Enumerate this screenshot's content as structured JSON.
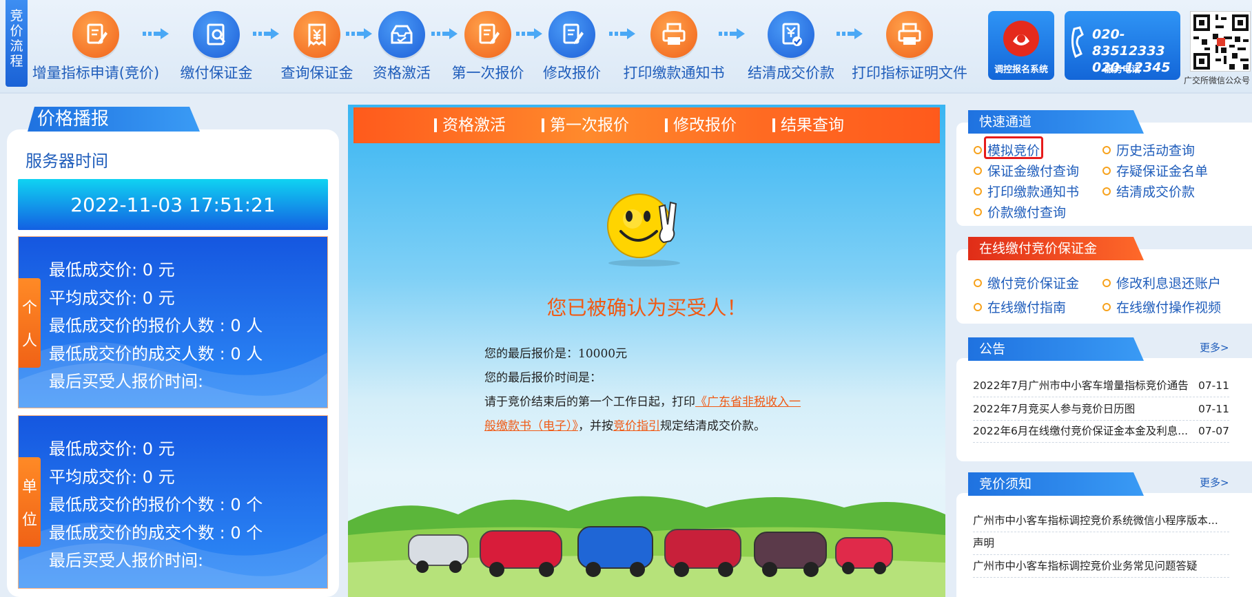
{
  "top_steps": {
    "side_tab": "竞价流程",
    "steps": [
      {
        "label": "增量指标申请(竞价)",
        "color": "orange",
        "icon": "form-edit-icon"
      },
      {
        "label": "缴付保证金",
        "color": "blue",
        "icon": "search-document-icon"
      },
      {
        "label": "查询保证金",
        "color": "orange",
        "icon": "yen-receipt-icon"
      },
      {
        "label": "资格激活",
        "color": "blue",
        "icon": "inbox-check-icon"
      },
      {
        "label": "第一次报价",
        "color": "orange",
        "icon": "form-edit-icon"
      },
      {
        "label": "修改报价",
        "color": "blue",
        "icon": "form-edit-icon"
      },
      {
        "label": "打印缴款通知书",
        "color": "orange",
        "icon": "printer-icon"
      },
      {
        "label": "结清成交价款",
        "color": "blue",
        "icon": "yen-check-icon"
      },
      {
        "label": "打印指标证明文件",
        "color": "orange",
        "icon": "printer-icon"
      }
    ],
    "badge_system": "调控报名系统",
    "phone_lines": [
      "020-83512333",
      "020-12345"
    ],
    "phone_caption": "服务电话",
    "qr_caption": "广交所微信公众号"
  },
  "left": {
    "tab_title": "价格播报",
    "server_label": "服务器时间",
    "server_time": "2022-11-03 17:51:21",
    "personal": {
      "tag": [
        "个",
        "人"
      ],
      "lines": [
        "最低成交价: 0 元",
        "平均成交价:  0 元",
        "最低成交价的报价人数 : 0 人",
        "最低成交价的成交人数 : 0 人",
        "最后买受人报价时间:"
      ]
    },
    "company": {
      "tag": [
        "单",
        "位"
      ],
      "lines": [
        "最低成交价: 0 元",
        "平均成交价:  0 元",
        "最低成交价的报价个数 : 0 个",
        "最低成交价的成交个数 : 0 个",
        "最后买受人报价时间:"
      ]
    }
  },
  "center": {
    "nav": [
      "资格激活",
      "第一次报价",
      "修改报价",
      "结果查询"
    ],
    "confirm": "您已被确认为买受人！",
    "line1": "您的最后报价是：10000元",
    "line2": "您的最后报价时间是：",
    "line3_pre": "请于竞价结束后的第一个工作日起，打印",
    "line3_link": "《广东省非税收入一般缴款书（电子）》",
    "line3_mid": "，并按",
    "line3_link2": "竞价指引",
    "line3_post": "规定结清成交价款。"
  },
  "right": {
    "quick_title": "快速通道",
    "quick_links": [
      "模拟竞价",
      "历史活动查询",
      "保证金缴付查询",
      "存疑保证金名单",
      "打印缴款通知书",
      "结清成交价款",
      "价款缴付查询"
    ],
    "online_title": "在线缴付竞价保证金",
    "online_links": [
      "缴付竞价保证金",
      "修改利息退还账户",
      "在线缴付指南",
      "在线缴付操作视频"
    ],
    "notice_title": "公告",
    "more": "更多>",
    "notices": [
      {
        "title": "2022年7月广州市中小客车增量指标竞价通告",
        "date": "07-11"
      },
      {
        "title": "2022年7月竞买人参与竞价日历图",
        "date": "07-11"
      },
      {
        "title": "2022年6月在线缴付竞价保证金本金及利息...",
        "date": "07-07"
      }
    ],
    "bid_title": "竞价须知",
    "bid_items": [
      "广州市中小客车指标调控竞价系统微信小程序版本...",
      "声明",
      "广州市中小客车指标调控竞价业务常见问题答疑"
    ]
  }
}
